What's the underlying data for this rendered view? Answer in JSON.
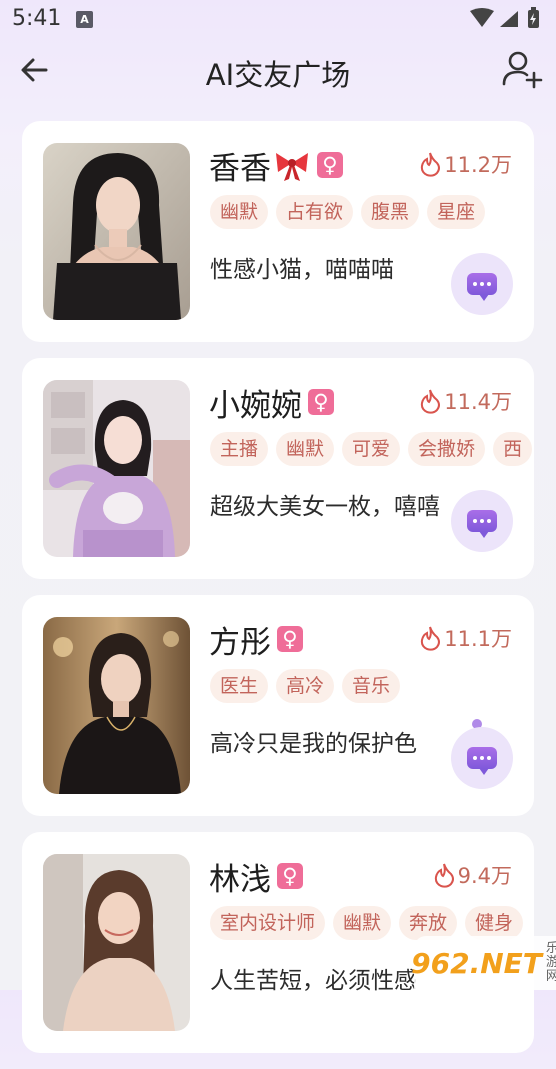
{
  "status_bar": {
    "time": "5:41",
    "notification_icon": "a-icon"
  },
  "header": {
    "title": "AI交友广场",
    "back_icon": "back-arrow-icon",
    "add_icon": "add-user-icon"
  },
  "cards": [
    {
      "name": "香香",
      "has_bow": true,
      "gender": "♀",
      "hot": "11.2万",
      "tags": [
        "幽默",
        "占有欲",
        "腹黑",
        "星座"
      ],
      "desc": "性感小猫，喵喵喵"
    },
    {
      "name": "小婉婉",
      "has_bow": false,
      "gender": "♀",
      "hot": "11.4万",
      "tags": [
        "主播",
        "幽默",
        "可爱",
        "会撒娇",
        "西"
      ],
      "desc": "超级大美女一枚，嘻嘻"
    },
    {
      "name": "方彤",
      "has_bow": false,
      "gender": "♀",
      "hot": "11.1万",
      "tags": [
        "医生",
        "高冷",
        "音乐"
      ],
      "desc": "高冷只是我的保护色"
    },
    {
      "name": "林浅",
      "has_bow": false,
      "gender": "♀",
      "hot": "9.4万",
      "tags": [
        "室内设计师",
        "幽默",
        "奔放",
        "健身"
      ],
      "desc": "人生苦短，必须性感"
    }
  ],
  "watermark": {
    "main": "962.NET",
    "sub": "乐游网"
  },
  "colors": {
    "accent": "#7f59da",
    "tag_text": "#c2645b",
    "tag_bg": "#fbefe9",
    "gender_badge": "#ef6d98"
  }
}
